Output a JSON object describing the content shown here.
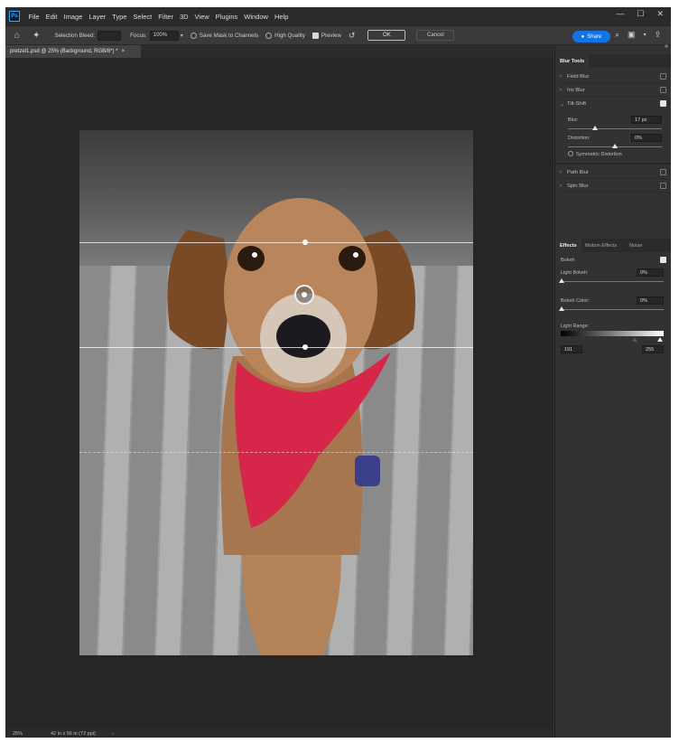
{
  "app": {
    "logo": "Ps"
  },
  "menu": [
    "File",
    "Edit",
    "Image",
    "Layer",
    "Type",
    "Select",
    "Filter",
    "3D",
    "View",
    "Plugins",
    "Window",
    "Help"
  ],
  "window_controls": {
    "minimize": "—",
    "maximize": "☐",
    "close": "✕"
  },
  "options": {
    "selection_bleed_label": "Selection Bleed:",
    "selection_bleed_value": "",
    "focus_label": "Focus:",
    "focus_value": "100%",
    "save_mask_label": "Save Mask to Channels",
    "high_quality_label": "High Quality",
    "preview_label": "Preview",
    "ok_label": "OK",
    "cancel_label": "Cancel",
    "share_label": "Share"
  },
  "document": {
    "tab_title": "pretzel1.psd @ 25% (Background, RGB/8*) *",
    "tab_close": "×"
  },
  "status": {
    "zoom": "25%",
    "doc_size": "42 in x 56 in (72 ppi)",
    "arrow": "›"
  },
  "blur_tools": {
    "tab_label": "Blur Tools",
    "items": [
      {
        "label": "Field Blur",
        "checked": false,
        "expanded": false
      },
      {
        "label": "Iris Blur",
        "checked": false,
        "expanded": false
      },
      {
        "label": "Tilt-Shift",
        "checked": true,
        "expanded": true
      },
      {
        "label": "Path Blur",
        "checked": false,
        "expanded": false
      },
      {
        "label": "Spin Blur",
        "checked": false,
        "expanded": false
      }
    ],
    "tilt_shift": {
      "blur_label": "Blur:",
      "blur_value": "17 px",
      "distortion_label": "Distortion:",
      "distortion_value": "0%",
      "symmetric_label": "Symmetric Distortion"
    }
  },
  "effects": {
    "tabs": [
      "Effects",
      "Motion Effects",
      "Noise"
    ],
    "bokeh_label": "Bokeh",
    "light_bokeh_label": "Light Bokeh:",
    "light_bokeh_value": "0%",
    "bokeh_color_label": "Bokeh Color:",
    "bokeh_color_value": "0%",
    "light_range_label": "Light Range:",
    "light_range_low": "191",
    "light_range_high": "255"
  }
}
